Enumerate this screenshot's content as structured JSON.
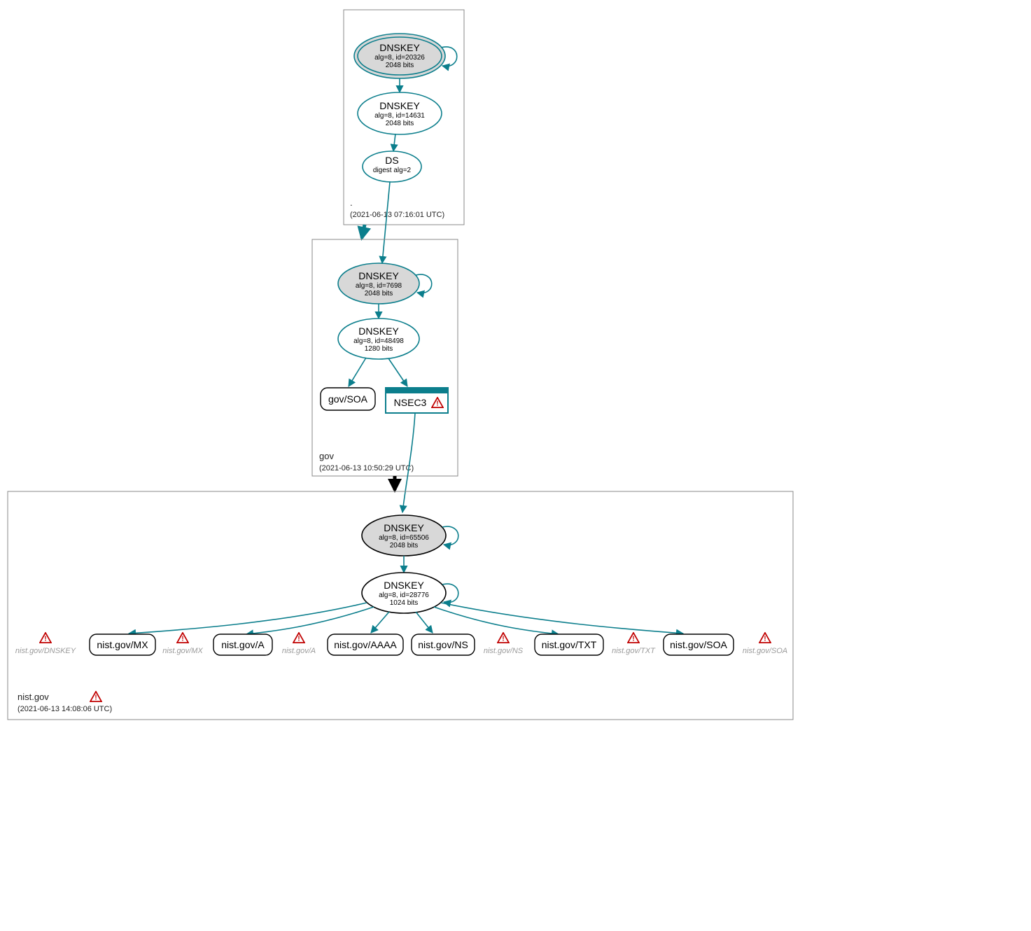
{
  "colors": {
    "teal": "#0b7e8c",
    "grey_fill": "#d8d8d8",
    "box_stroke": "#888"
  },
  "chart_data": {
    "type": "diagram",
    "title": "DNSSEC authentication chain",
    "zones": [
      {
        "name": ".",
        "timestamp": "2021-06-13 07:16:01 UTC",
        "nodes": [
          {
            "id": "root-ksk",
            "kind": "DNSKEY",
            "trust_anchor": true,
            "alg": 8,
            "key_id": 20326,
            "bits": 2048
          },
          {
            "id": "root-zsk",
            "kind": "DNSKEY",
            "trust_anchor": false,
            "alg": 8,
            "key_id": 14631,
            "bits": 2048
          },
          {
            "id": "root-ds",
            "kind": "DS",
            "digest_alg": 2
          }
        ],
        "edges": [
          {
            "from": "root-ksk",
            "to": "root-ksk",
            "self": true
          },
          {
            "from": "root-ksk",
            "to": "root-zsk"
          },
          {
            "from": "root-zsk",
            "to": "root-ds"
          }
        ]
      },
      {
        "name": "gov",
        "timestamp": "2021-06-13 10:50:29 UTC",
        "nodes": [
          {
            "id": "gov-ksk",
            "kind": "DNSKEY",
            "alg": 8,
            "key_id": 7698,
            "bits": 2048
          },
          {
            "id": "gov-zsk",
            "kind": "DNSKEY",
            "alg": 8,
            "key_id": 48498,
            "bits": 1280
          },
          {
            "id": "gov-soa",
            "kind": "RR",
            "label": "gov/SOA"
          },
          {
            "id": "gov-nsec3",
            "kind": "NSEC3",
            "label": "NSEC3",
            "warning": true
          }
        ],
        "edges": [
          {
            "from": "root-ds",
            "to": "gov-ksk"
          },
          {
            "from": "gov-ksk",
            "to": "gov-ksk",
            "self": true
          },
          {
            "from": "gov-ksk",
            "to": "gov-zsk"
          },
          {
            "from": "gov-zsk",
            "to": "gov-soa"
          },
          {
            "from": "gov-zsk",
            "to": "gov-nsec3"
          }
        ],
        "delegation_edge": {
          "from": "root-zone",
          "to": "gov-zone",
          "secure": true
        }
      },
      {
        "name": "nist.gov",
        "timestamp": "2021-06-13 14:08:06 UTC",
        "zone_warning": true,
        "nodes": [
          {
            "id": "nist-ksk",
            "kind": "DNSKEY",
            "alg": 8,
            "key_id": 65506,
            "bits": 2048
          },
          {
            "id": "nist-zsk",
            "kind": "DNSKEY",
            "alg": 8,
            "key_id": 28776,
            "bits": 1024
          }
        ],
        "rrsets": [
          {
            "label": "nist.gov/MX"
          },
          {
            "label": "nist.gov/A"
          },
          {
            "label": "nist.gov/AAAA"
          },
          {
            "label": "nist.gov/NS"
          },
          {
            "label": "nist.gov/TXT"
          },
          {
            "label": "nist.gov/SOA"
          }
        ],
        "ghost_rrsets": [
          "nist.gov/DNSKEY",
          "nist.gov/MX",
          "nist.gov/A",
          "nist.gov/NS",
          "nist.gov/TXT",
          "nist.gov/SOA"
        ],
        "edges": [
          {
            "from": "nist-ksk",
            "to": "nist-ksk",
            "self": true
          },
          {
            "from": "nist-ksk",
            "to": "nist-zsk"
          },
          {
            "from": "nist-zsk",
            "to": "nist-zsk",
            "self": true
          },
          {
            "from": "nist-zsk",
            "to": "each-rrset"
          }
        ],
        "delegation_edge": {
          "from": "gov-nsec3",
          "to": "nist-zone",
          "secure": false
        }
      }
    ]
  },
  "root": {
    "zone_name": ".",
    "zone_ts": "(2021-06-13 07:16:01 UTC)",
    "ksk_title": "DNSKEY",
    "ksk_line1": "alg=8, id=20326",
    "ksk_line2": "2048 bits",
    "zsk_title": "DNSKEY",
    "zsk_line1": "alg=8, id=14631",
    "zsk_line2": "2048 bits",
    "ds_title": "DS",
    "ds_line1": "digest alg=2"
  },
  "gov": {
    "zone_name": "gov",
    "zone_ts": "(2021-06-13 10:50:29 UTC)",
    "ksk_title": "DNSKEY",
    "ksk_line1": "alg=8, id=7698",
    "ksk_line2": "2048 bits",
    "zsk_title": "DNSKEY",
    "zsk_line1": "alg=8, id=48498",
    "zsk_line2": "1280 bits",
    "soa_label": "gov/SOA",
    "nsec3_label": "NSEC3"
  },
  "nist": {
    "zone_name": "nist.gov",
    "zone_ts": "(2021-06-13 14:08:06 UTC)",
    "ksk_title": "DNSKEY",
    "ksk_line1": "alg=8, id=65506",
    "ksk_line2": "2048 bits",
    "zsk_title": "DNSKEY",
    "zsk_line1": "alg=8, id=28776",
    "zsk_line2": "1024 bits",
    "rr_mx": "nist.gov/MX",
    "rr_a": "nist.gov/A",
    "rr_aaaa": "nist.gov/AAAA",
    "rr_ns": "nist.gov/NS",
    "rr_txt": "nist.gov/TXT",
    "rr_soa": "nist.gov/SOA",
    "ghost_dnskey": "nist.gov/DNSKEY",
    "ghost_mx": "nist.gov/MX",
    "ghost_a": "nist.gov/A",
    "ghost_ns": "nist.gov/NS",
    "ghost_txt": "nist.gov/TXT",
    "ghost_soa": "nist.gov/SOA"
  }
}
